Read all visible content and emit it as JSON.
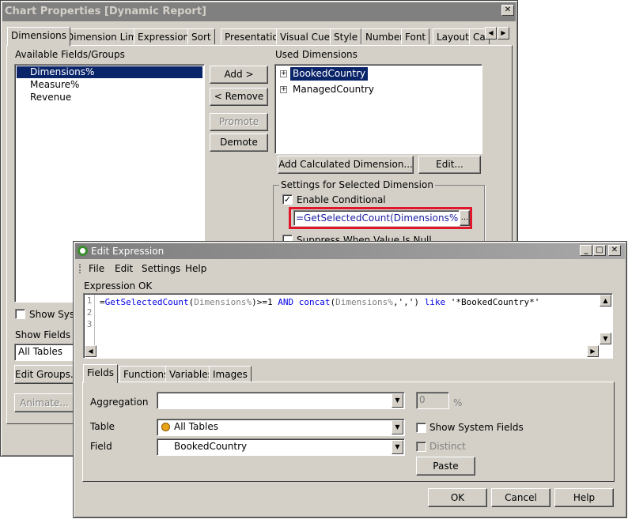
{
  "chart_props": {
    "title": "Chart Properties [Dynamic Report]",
    "close": "✕",
    "tabs": [
      "Dimensions",
      "Dimension Limits",
      "Expressions",
      "Sort",
      "Presentation",
      "Visual Cues",
      "Style",
      "Number",
      "Font",
      "Layout",
      "Ca"
    ],
    "available_label": "Available Fields/Groups",
    "available_items": [
      "Dimensions%",
      "Measure%",
      "Revenue"
    ],
    "used_label": "Used Dimensions",
    "used_items": [
      "BookedCountry",
      "ManagedCountry"
    ],
    "add_btn": "Add >",
    "remove_btn": "< Remove",
    "promote_btn": "Promote",
    "demote_btn": "Demote",
    "add_calc_btn": "Add Calculated Dimension...",
    "edit_btn": "Edit...",
    "settings_label": "Settings for Selected Dimension",
    "enable_conditional": "Enable Conditional",
    "conditional_expr": "=GetSelectedCount(Dimensions%)>=",
    "ellipsis": "...",
    "suppress_partial": "Suppress When Value Is Null",
    "show_system_partial": "Show Syste",
    "show_fields_partial": "Show Fields fro",
    "all_tables": "All Tables",
    "edit_groups": "Edit Groups...",
    "animate": "Animate..."
  },
  "edit_expr": {
    "title": "Edit Expression",
    "menu": [
      "File",
      "Edit",
      "Settings",
      "Help"
    ],
    "status": "Expression OK",
    "line_numbers": [
      "1",
      "2",
      "3"
    ],
    "code": {
      "eq": "=",
      "fn1": "GetSelectedCount",
      "p1": "(",
      "arg1": "Dimensions%",
      "p2": ")>=1 ",
      "and": "AND",
      "sp": " ",
      "fn2": "concat",
      "p3": "(",
      "arg2": "Dimensions%",
      "p4": ",',') ",
      "like": "like",
      "str": " '*BookedCountry*'"
    },
    "tabs": [
      "Fields",
      "Functions",
      "Variables",
      "Images"
    ],
    "aggregation_label": "Aggregation",
    "aggregation_value": "",
    "number_value": "0",
    "percent": "%",
    "table_label": "Table",
    "table_value": "All Tables",
    "field_label": "Field",
    "field_value": "BookedCountry",
    "show_system_fields": "Show System Fields",
    "distinct": "Distinct",
    "paste_btn": "Paste",
    "ok_btn": "OK",
    "cancel_btn": "Cancel",
    "help_btn": "Help"
  }
}
